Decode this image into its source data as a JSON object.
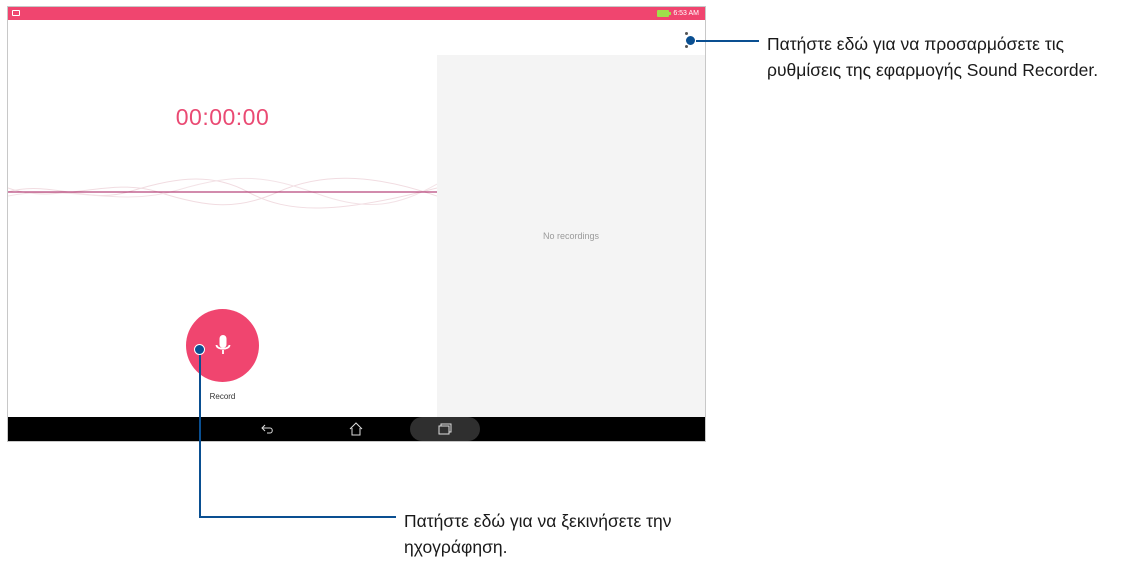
{
  "status_bar": {
    "time": "6:53 AM"
  },
  "app": {
    "timer": "00:00:00",
    "record_label": "Record",
    "empty_list_text": "No recordings"
  },
  "callouts": {
    "settings_text": "Πατήστε εδώ για να προσαρμόσετε τις ρυθμίσεις της εφαρμογής Sound Recorder.",
    "record_text": "Πατήστε εδώ για να ξεκινήσετε την ηχογράφηση."
  },
  "colors": {
    "accent": "#f0456f",
    "timer": "#ea4a73",
    "callout": "#0a4f91",
    "battery": "#9ee04a"
  },
  "icons": [
    "notification-icon",
    "battery-charging-icon",
    "more-vert-icon",
    "microphone-icon",
    "back-icon",
    "home-icon",
    "recent-apps-icon"
  ]
}
